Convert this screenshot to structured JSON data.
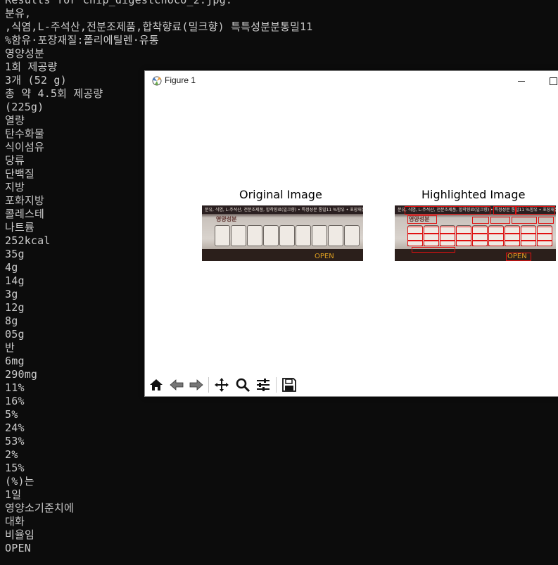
{
  "terminal": {
    "lines": [
      "Results for chip_digestchoco_2.jpg:",
      "분유,",
      ",식염,L-주석산,전분조제품,합착향료(밀크향) 특특성분분통밀11",
      "%함유·포장재질:폴리에틸렌·유통",
      "영양성분",
      "1회 제공량",
      "3개 (52 g)",
      "총 약 4.5회 제공량",
      "(225g)",
      "열량",
      "탄수화물",
      "식이섬유",
      "당류",
      "단백질",
      "지방",
      "포화지방",
      "콜레스테",
      "나트륨",
      "252kcal",
      "35g",
      "4g",
      "14g",
      "3g",
      "12g",
      "8g",
      "05g",
      "반",
      "6mg",
      "290mg",
      "11%",
      "16%",
      "5%",
      "24%",
      "53%",
      "2%",
      "15%",
      "(%)는",
      "1일",
      "영양소기준치에",
      "대화",
      "비율임",
      "OPEN"
    ]
  },
  "figure_window": {
    "title": "Figure 1",
    "subplots": [
      {
        "title": "Original Image"
      },
      {
        "title": "Highlighted Image"
      }
    ],
    "photo_text": {
      "strip": "분유, 식염, L-주석산, 전분조제품, 합착향료(밀크향) • 특정성분 통밀11 %함유 • 포장재질:폴리에틸렌 • 유통",
      "panel_title": "영양성분",
      "open_label": "OPEN"
    }
  },
  "toolbar": {
    "buttons": [
      "home-icon",
      "back-icon",
      "forward-icon",
      "pan-icon",
      "zoom-icon",
      "configure-subplots-icon",
      "save-icon"
    ]
  },
  "colors": {
    "terminal_bg": "#0c0c0c",
    "terminal_fg": "#cccccc",
    "highlight_box": "#e01010"
  }
}
